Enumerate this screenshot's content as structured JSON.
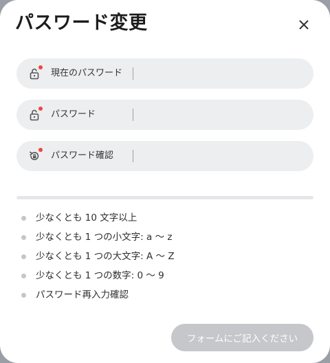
{
  "dialog": {
    "title": "パスワード変更",
    "close_icon": "close-icon"
  },
  "fields": [
    {
      "label": "現在のパスワード",
      "icon": "lock-icon",
      "value": "",
      "required": true
    },
    {
      "label": "パスワード",
      "icon": "lock-icon",
      "value": "",
      "required": true
    },
    {
      "label": "パスワード確認",
      "icon": "reset-lock-icon",
      "value": "",
      "required": true
    }
  ],
  "strength_meter": {
    "level": 0
  },
  "requirements": [
    "少なくとも 10 文字以上",
    "少なくとも 1 つの小文字: a 〜 z",
    "少なくとも 1 つの大文字: A 〜 Z",
    "少なくとも 1 つの数字: 0 〜 9",
    "パスワード再入力確認"
  ],
  "submit_label": "フォームにご記入ください",
  "colors": {
    "required_dot": "#f0463c",
    "field_bg": "#eceef0",
    "button_disabled": "#c5c7ca",
    "bullet": "#c3c6ca"
  }
}
